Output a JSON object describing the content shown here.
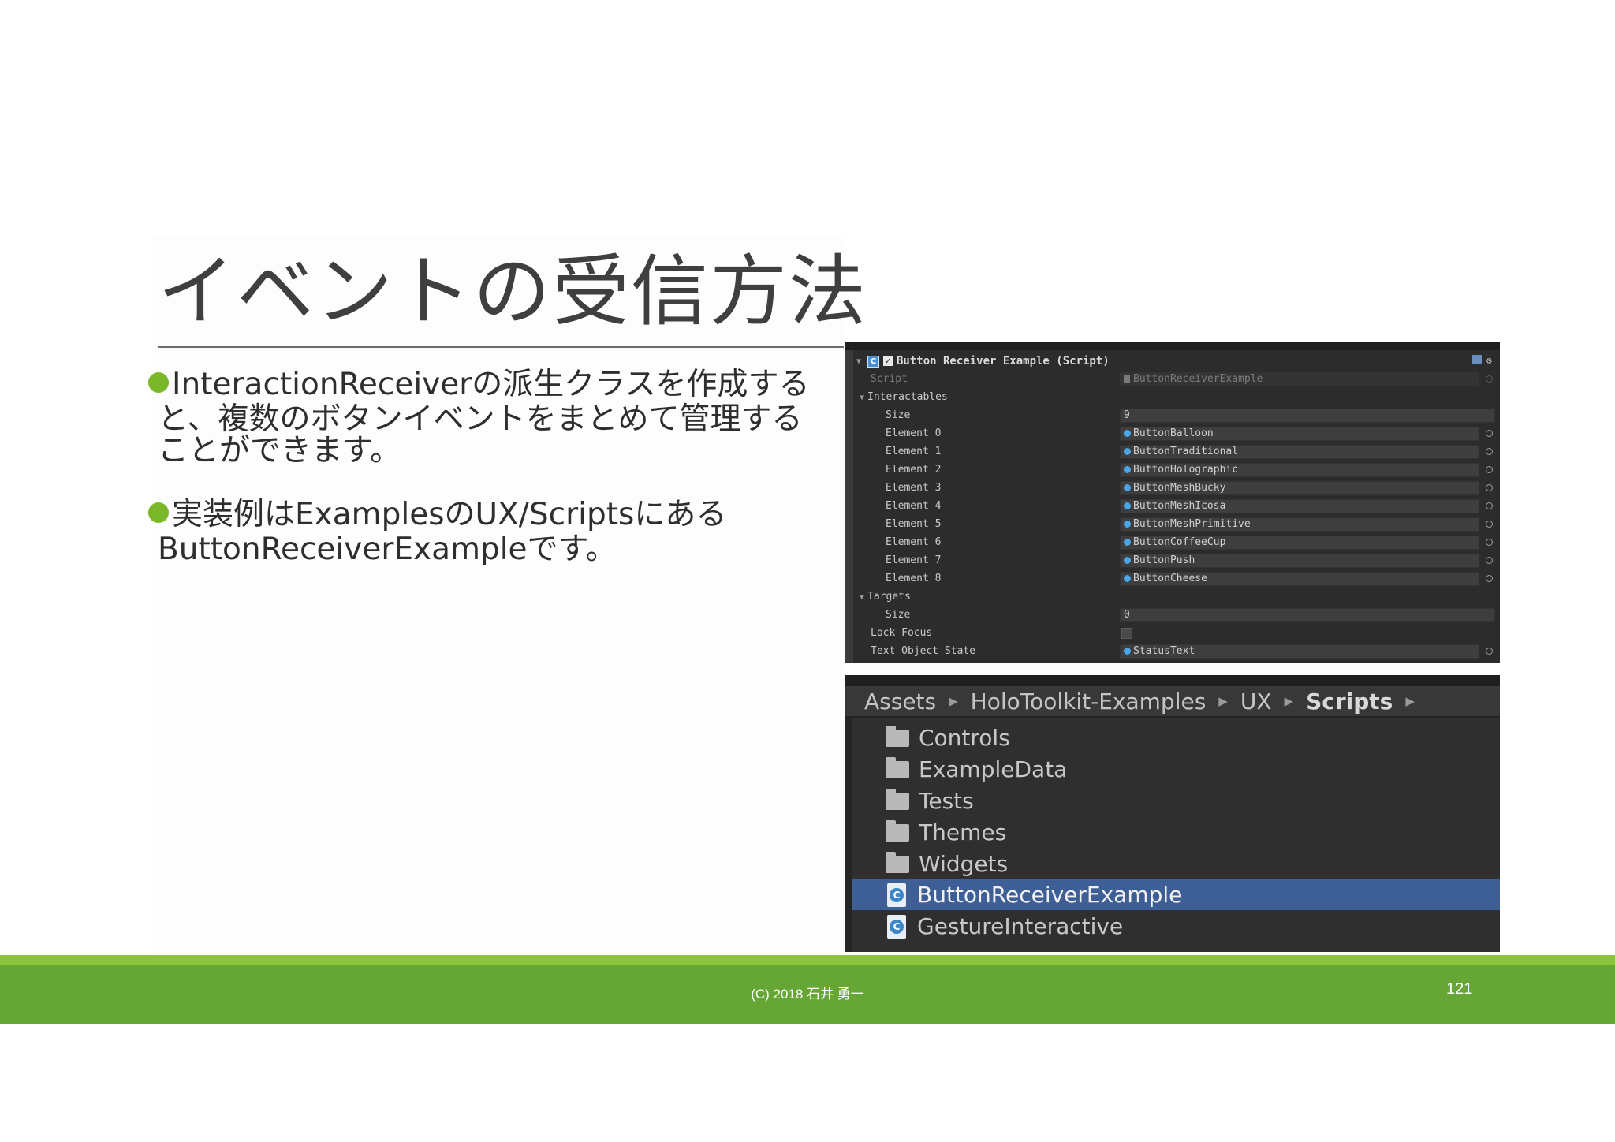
{
  "slide": {
    "title": "イベントの受信方法",
    "bullets": [
      {
        "lines": [
          "InteractionReceiverの派生クラスを作成する",
          "と、複数のボタンイベントをまとめて管理する",
          "ことができます。"
        ]
      },
      {
        "lines": [
          "実装例はExamplesのUX/Scriptsにある",
          "ButtonReceiverExampleです。"
        ]
      }
    ],
    "bullet_color": "#7ab829",
    "footer": {
      "copyright": "(C) 2018 石井 勇一",
      "page_number": "121"
    },
    "footer_color": "#66a634"
  },
  "inspector": {
    "component_title": "Button Receiver Example (Script)",
    "script_label": "Script",
    "script_value": "ButtonReceiverExample",
    "interactables_label": "Interactables",
    "size_label": "Size",
    "interactables_size": "9",
    "elements": [
      {
        "label": "Element 0",
        "value": "ButtonBalloon"
      },
      {
        "label": "Element 1",
        "value": "ButtonTraditional"
      },
      {
        "label": "Element 2",
        "value": "ButtonHolographic"
      },
      {
        "label": "Element 3",
        "value": "ButtonMeshBucky"
      },
      {
        "label": "Element 4",
        "value": "ButtonMeshIcosa"
      },
      {
        "label": "Element 5",
        "value": "ButtonMeshPrimitive"
      },
      {
        "label": "Element 6",
        "value": "ButtonCoffeeCup"
      },
      {
        "label": "Element 7",
        "value": "ButtonPush"
      },
      {
        "label": "Element 8",
        "value": "ButtonCheese"
      }
    ],
    "targets_label": "Targets",
    "targets_size": "0",
    "lock_focus_label": "Lock Focus",
    "lock_focus_checked": false,
    "text_object_state_label": "Text Object State",
    "text_object_state_value": "StatusText"
  },
  "browser": {
    "breadcrumbs": [
      "Assets",
      "HoloToolkit-Examples",
      "UX",
      "Scripts"
    ],
    "items": [
      {
        "name": "Controls",
        "kind": "folder"
      },
      {
        "name": "ExampleData",
        "kind": "folder"
      },
      {
        "name": "Tests",
        "kind": "folder"
      },
      {
        "name": "Themes",
        "kind": "folder"
      },
      {
        "name": "Widgets",
        "kind": "folder"
      },
      {
        "name": "ButtonReceiverExample",
        "kind": "script",
        "selected": true
      },
      {
        "name": "GestureInteractive",
        "kind": "script"
      }
    ],
    "selection_color": "#3e5f96"
  }
}
